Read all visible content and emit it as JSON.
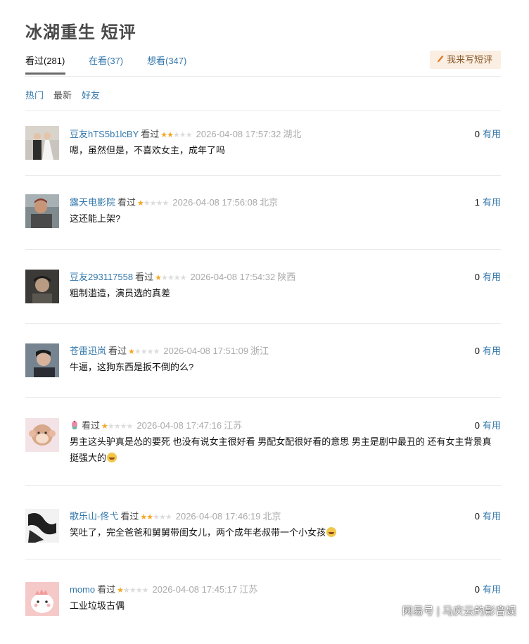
{
  "page_title": "冰湖重生 短评",
  "tabs": [
    {
      "label": "看过(281)",
      "active": true
    },
    {
      "label": "在看(37)",
      "active": false
    },
    {
      "label": "想看(347)",
      "active": false
    }
  ],
  "write_button": "我来写短评",
  "sorts": [
    "热门",
    "最新",
    "好友"
  ],
  "comments": [
    {
      "user": "豆友hTS5b1lcBY",
      "status": "看过",
      "rating": 2,
      "time": "2026-04-08 17:57:32",
      "location": "湖北",
      "votes": "0",
      "vote_label": "有用",
      "text": "嗯，虽然但是，不喜欢女主，成年了吗",
      "avatar": "wedding-photo-avatar"
    },
    {
      "user": "露天电影院",
      "status": "看过",
      "rating": 1,
      "time": "2026-04-08 17:56:08",
      "location": "北京",
      "votes": "1",
      "vote_label": "有用",
      "text": "这还能上架?",
      "avatar": "elderly-man-avatar"
    },
    {
      "user": "豆友293117558",
      "status": "看过",
      "rating": 1,
      "time": "2026-04-08 17:54:32",
      "location": "陕西",
      "votes": "0",
      "vote_label": "有用",
      "text": "粗制滥造，演员选的真差",
      "avatar": "cap-man-avatar"
    },
    {
      "user": "苍雷迅岚",
      "status": "看过",
      "rating": 1,
      "time": "2026-04-08 17:51:09",
      "location": "浙江",
      "votes": "0",
      "vote_label": "有用",
      "text": "牛逼，这狗东西是扳不倒的么?",
      "avatar": "young-man-avatar"
    },
    {
      "user": "",
      "status": "看过",
      "rating": 1,
      "time": "2026-04-08 17:47:16",
      "location": "江苏",
      "votes": "0",
      "vote_label": "有用",
      "text": "男主这头驴真是怂的要死 也没有说女主很好看 男配女配很好看的意思 男主是剧中最丑的 还有女主背景真挺强大的",
      "avatar": "cartoon-monkey-avatar",
      "name_icon": "cupcake-icon",
      "emoji": true
    },
    {
      "user": "歌乐山-佟弋",
      "status": "看过",
      "rating": 2,
      "time": "2026-04-08 17:46:19",
      "location": "北京",
      "votes": "0",
      "vote_label": "有用",
      "text": "笑吐了，完全爸爸和舅舅带闺女儿，两个成年老叔带一个小女孩",
      "avatar": "sketch-drawing-avatar",
      "emoji": true
    },
    {
      "user": "momo",
      "status": "看过",
      "rating": 1,
      "time": "2026-04-08 17:45:17",
      "location": "江苏",
      "votes": "0",
      "vote_label": "有用",
      "text": "工业垃圾古偶",
      "avatar": "pink-dino-avatar"
    }
  ],
  "watermark": "网易号 | 马庆云的影音娱"
}
